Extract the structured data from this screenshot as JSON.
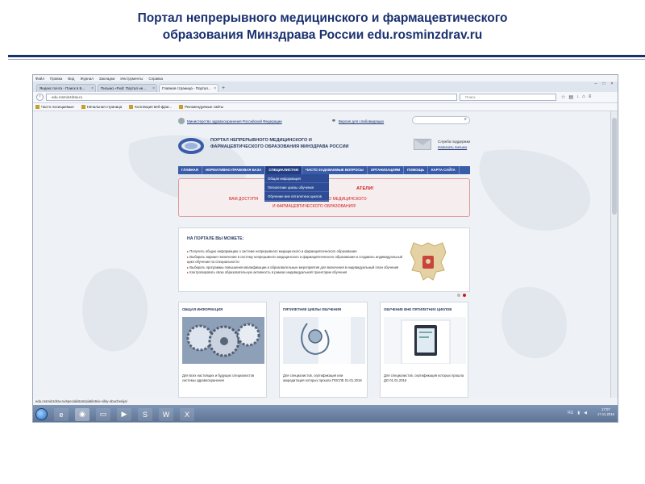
{
  "slide": {
    "title_line1": "Портал непрерывного медицинского и фармацевтического",
    "title_line2": "образования Минздрава России edu.rosminzdrav.ru",
    "title_color": "#1a3170"
  },
  "browser": {
    "menu": [
      "Файл",
      "Правка",
      "Вид",
      "Журнал",
      "Закладки",
      "Инструменты",
      "Справка"
    ],
    "tabs": [
      {
        "label": "Яндекс почта - Поиск в Б..."
      },
      {
        "label": "Письмо «Fwd: Портал не..."
      },
      {
        "label": "Главная страница - Портал..."
      }
    ],
    "new_tab": "+",
    "url": "edu.rosminzdrav.ru",
    "search_placeholder": "Поиск",
    "bookmarks": [
      "Часто посещаемые",
      "Начальная страница",
      "Коллекция веб-фраг...",
      "Рекомендуемые сайты"
    ],
    "status_url": "edu.rosminzdrav.ru/specialistam/piatiletnie-cikly-obuchenija/"
  },
  "site": {
    "ministry_link": "Министерство здравоохранения Российской Федерации",
    "accessible_link": "Версия для слабовидящих",
    "logo_line1": "ПОРТАЛ НЕПРЕРЫВНОГО МЕДИЦИНСКОГО И",
    "logo_line2": "ФАРМАЦЕВТИЧЕСКОГО ОБРАЗОВАНИЯ МИНЗДРАВА РОССИИ",
    "support_label": "Служба поддержки",
    "support_link": "Написать письмо",
    "nav": [
      "ГЛАВНАЯ",
      "НОРМАТИВНО-ПРАВОВАЯ БАЗА",
      "СПЕЦИАЛИСТАМ",
      "ЧАСТО ЗАДАВАЕМЫЕ ВОПРОСЫ",
      "ОРГАНИЗАЦИЯМ",
      "ПОМОЩЬ",
      "КАРТА САЙТА"
    ],
    "dropdown": [
      "Общая информация",
      "Пятилетние циклы обучения",
      "Обучение вне пятилетних циклов"
    ],
    "alert_line1": "АТЕЛИ!",
    "alert_line2_left": "ВАМ ДОСТУПН",
    "alert_line2_right": "РЕРЫВНОГО МЕДИЦИНСКОГО",
    "alert_line3": "И ФАРМАЦЕВТИЧЕСКОГО ОБРАЗОВАНИЯ!",
    "can_do_title": "НА ПОРТАЛЕ ВЫ МОЖЕТЕ:",
    "can_do_items": [
      "Получить общую информацию о системе непрерывного медицинского и фармацевтического образования",
      "Выбирать вариант включения в систему непрерывного медицинского и фармацевтического образования и создавать индивидуальный цикл обучения по специальности",
      "Выбирать программы повышения квалификации и образовательные мероприятия для включения в индивидуальный план обучения",
      "Контролировать свою образовательную активность в рамках индивидуальной траектории обучения"
    ],
    "cards": [
      {
        "title": "ОБЩАЯ ИНФОРМАЦИЯ",
        "text": "Для всех настоящих и будущих специалистов системы здравоохранения"
      },
      {
        "title": "ПЯТИЛЕТНИЕ ЦИКЛЫ ОБУЧЕНИЯ",
        "text": "Для специалистов, сертификация или аккредитация которых прошла ПОСЛЕ 01.01.2016"
      },
      {
        "title": "ОБУЧЕНИЕ ВНЕ ПЯТИЛЕТНИХ ЦИКЛОВ",
        "text": "Для специалистов, сертификация которых прошла ДО 01.01.2016"
      }
    ]
  },
  "taskbar": {
    "time": "17:07",
    "date": "17.11.2016"
  }
}
